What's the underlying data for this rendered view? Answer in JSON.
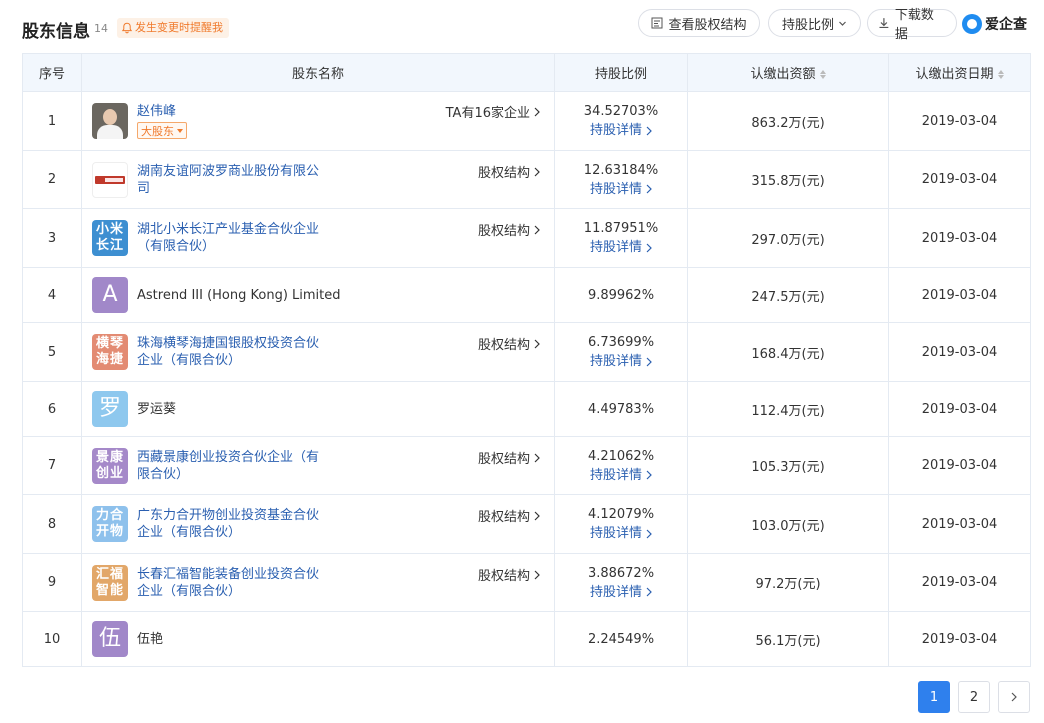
{
  "header": {
    "title": "股东信息",
    "count": "14",
    "notify_label": "发生变更时提醒我",
    "equity_structure_button": "查看股权结构",
    "ratio_button": "持股比例",
    "download_button": "下载数据",
    "brand": "爱企查"
  },
  "table": {
    "columns": {
      "index": "序号",
      "name": "股东名称",
      "ratio": "持股比例",
      "amount": "认缴出资额",
      "date": "认缴出资日期"
    },
    "rows": [
      {
        "index": "1",
        "name": "赵伟峰",
        "avatar_type": "photo",
        "avatar_text": "",
        "avatar_color": "#6b6760",
        "tag": "大股东",
        "link_label": "TA有16家企业",
        "ratio": "34.52703%",
        "detail": "持股详情",
        "amount": "863.2万(元)",
        "date": "2019-03-04"
      },
      {
        "index": "2",
        "name": "湖南友谊阿波罗商业股份有限公司",
        "avatar_type": "logo",
        "avatar_text": "",
        "avatar_color": "#c0392b",
        "tag": "",
        "link_label": "股权结构",
        "ratio": "12.63184%",
        "detail": "持股详情",
        "amount": "315.8万(元)",
        "date": "2019-03-04"
      },
      {
        "index": "3",
        "name": "湖北小米长江产业基金合伙企业（有限合伙）",
        "avatar_type": "text",
        "avatar_text": "小米长江",
        "avatar_color": "#3d8fd1",
        "tag": "",
        "link_label": "股权结构",
        "ratio": "11.87951%",
        "detail": "持股详情",
        "amount": "297.0万(元)",
        "date": "2019-03-04"
      },
      {
        "index": "4",
        "name": "Astrend III (Hong Kong) Limited",
        "avatar_type": "big",
        "avatar_text": "A",
        "avatar_color": "#a188c9",
        "tag": "",
        "link_label": "",
        "ratio": "9.89962%",
        "detail": "",
        "amount": "247.5万(元)",
        "date": "2019-03-04"
      },
      {
        "index": "5",
        "name": "珠海横琴海捷国银股权投资合伙企业（有限合伙）",
        "avatar_type": "text",
        "avatar_text": "横琴海捷",
        "avatar_color": "#e38b73",
        "tag": "",
        "link_label": "股权结构",
        "ratio": "6.73699%",
        "detail": "持股详情",
        "amount": "168.4万(元)",
        "date": "2019-03-04"
      },
      {
        "index": "6",
        "name": "罗运葵",
        "avatar_type": "big",
        "avatar_text": "罗",
        "avatar_color": "#8ec8ee",
        "tag": "",
        "link_label": "",
        "ratio": "4.49783%",
        "detail": "",
        "amount": "112.4万(元)",
        "date": "2019-03-04"
      },
      {
        "index": "7",
        "name": "西藏景康创业投资合伙企业（有限合伙）",
        "avatar_type": "text",
        "avatar_text": "景康创业",
        "avatar_color": "#a589c9",
        "tag": "",
        "link_label": "股权结构",
        "ratio": "4.21062%",
        "detail": "持股详情",
        "amount": "105.3万(元)",
        "date": "2019-03-04"
      },
      {
        "index": "8",
        "name": "广东力合开物创业投资基金合伙企业（有限合伙）",
        "avatar_type": "text",
        "avatar_text": "力合开物",
        "avatar_color": "#8ec1ec",
        "tag": "",
        "link_label": "股权结构",
        "ratio": "4.12079%",
        "detail": "持股详情",
        "amount": "103.0万(元)",
        "date": "2019-03-04"
      },
      {
        "index": "9",
        "name": "长春汇福智能装备创业投资合伙企业（有限合伙）",
        "avatar_type": "text",
        "avatar_text": "汇福智能",
        "avatar_color": "#e2a769",
        "tag": "",
        "link_label": "股权结构",
        "ratio": "3.88672%",
        "detail": "持股详情",
        "amount": "97.2万(元)",
        "date": "2019-03-04"
      },
      {
        "index": "10",
        "name": "伍艳",
        "avatar_type": "big",
        "avatar_text": "伍",
        "avatar_color": "#a188c9",
        "tag": "",
        "link_label": "",
        "ratio": "2.24549%",
        "detail": "",
        "amount": "56.1万(元)",
        "date": "2019-03-04"
      }
    ]
  },
  "pagination": {
    "pages": [
      "1",
      "2"
    ],
    "current": "1"
  }
}
